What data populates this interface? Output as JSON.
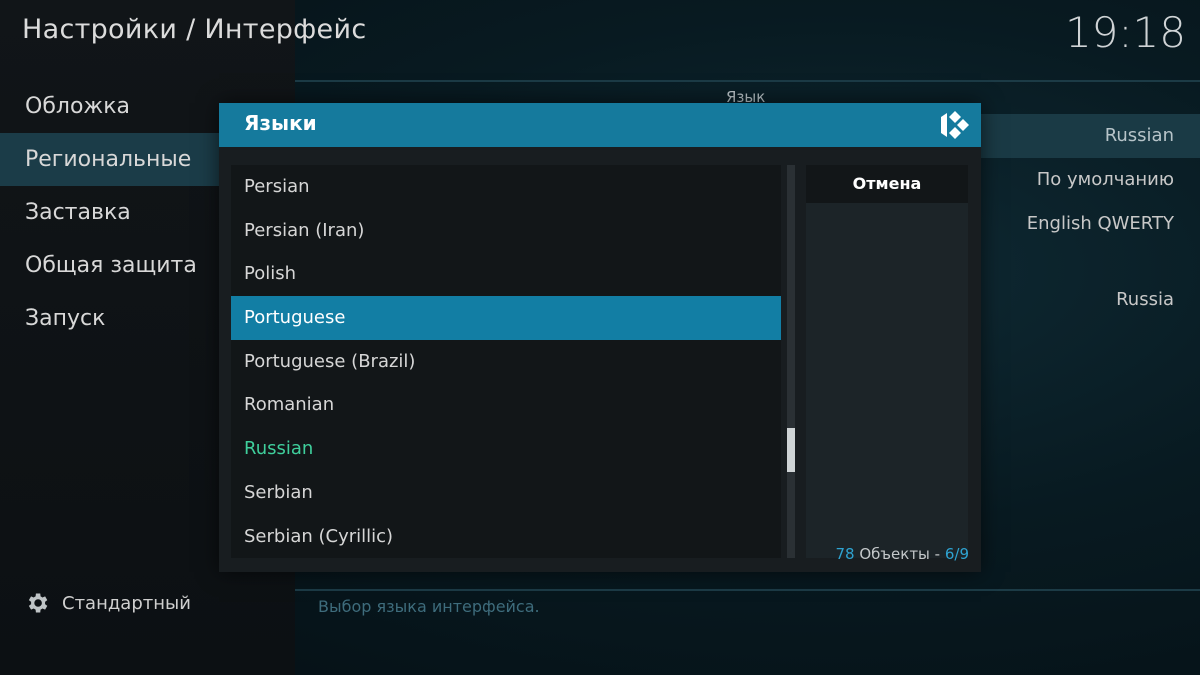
{
  "header": {
    "title": "Настройки / Интерфейс",
    "clock": "19:18"
  },
  "nav": {
    "items": [
      {
        "label": "Обложка"
      },
      {
        "label": "Региональные",
        "active": true
      },
      {
        "label": "Заставка"
      },
      {
        "label": "Общая защита"
      },
      {
        "label": "Запуск"
      }
    ]
  },
  "profile": {
    "label": "Стандартный"
  },
  "background": {
    "section_label": "Язык",
    "rows": [
      "Russian",
      "По умолчанию",
      "English QWERTY",
      "Russia"
    ],
    "description": "Выбор языка интерфейса."
  },
  "dialog": {
    "title": "Языки",
    "items": [
      {
        "label": "Persian"
      },
      {
        "label": "Persian (Iran)"
      },
      {
        "label": "Polish"
      },
      {
        "label": "Portuguese",
        "focused": true
      },
      {
        "label": "Portuguese (Brazil)"
      },
      {
        "label": "Romanian"
      },
      {
        "label": "Russian",
        "current": true
      },
      {
        "label": "Serbian"
      },
      {
        "label": "Serbian (Cyrillic)"
      }
    ],
    "cancel_label": "Отмена",
    "count": {
      "total": "78",
      "label": " Объекты - ",
      "page": "6/9"
    }
  },
  "colors": {
    "accent": "#157a9d",
    "focus": "#127ea4",
    "current": "#3fcf9c"
  }
}
